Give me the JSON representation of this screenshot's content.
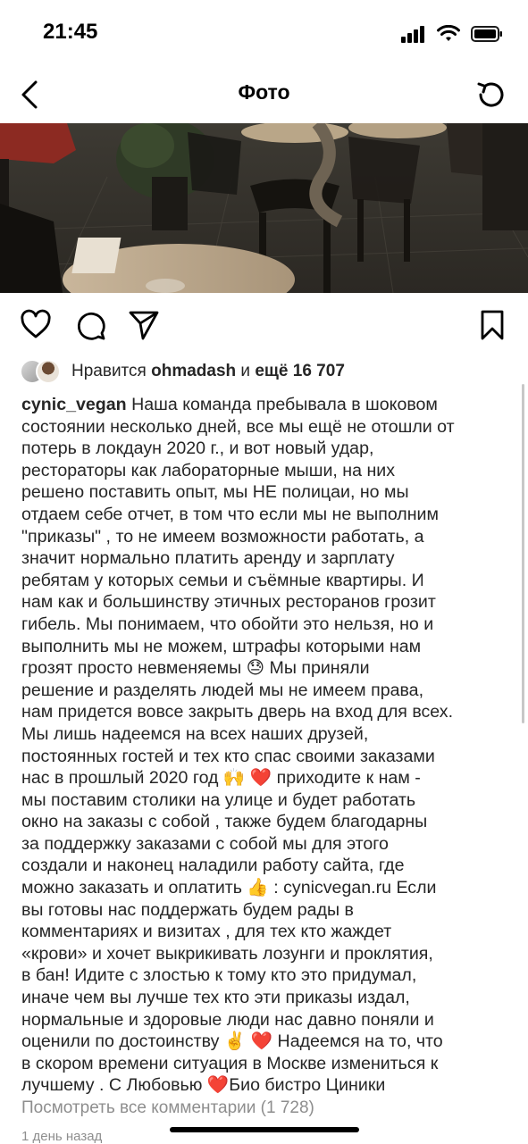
{
  "status_bar": {
    "time": "21:45"
  },
  "nav": {
    "title": "Фото",
    "back_icon": "chevron-left-icon",
    "refresh_icon": "refresh-icon"
  },
  "photo": {
    "content": "cafe-interior-photo"
  },
  "actions": {
    "like_icon": "heart-icon",
    "comment_icon": "comment-icon",
    "share_icon": "send-icon",
    "save_icon": "bookmark-icon"
  },
  "likes": {
    "prefix": "Нравится ",
    "user": "ohmadash",
    "joiner": " и ",
    "count_text": "ещё 16 707"
  },
  "caption": {
    "username": "cynic_vegan",
    "text": " Наша команда пребывала в шоковом\nсостоянии несколько дней, все мы ещё не отошли от\nпотерь в локдаун 2020 г., и вот новый удар,\nрестораторы как лабораторные мыши, на них\nрешено поставить опыт, мы НЕ полицаи, но мы\nотдаем себе отчет, в том что если мы не выполним\n\"приказы\" , то не имеем возможности работать, а\nзначит нормально платить аренду и зарплату\nребятам у которых семьи и съёмные квартиры.  И\nнам как и большинству этичных ресторанов грозит\nгибель.  Мы понимаем, что обойти это нельзя, но и\nвыполнить мы не можем, штрафы которыми нам\nгрозят просто невменяемы 😓  Мы приняли\nрешение и разделять людей мы не имеем права,\nнам придется вовсе закрыть дверь на вход для всех.\nМы лишь надеемся на всех наших друзей,\nпостоянных гостей и тех кто спас своими заказами\nнас в прошлый 2020 год 🙌 ❤️  приходите к нам -\nмы поставим столики на улице и будет работать\nокно на заказы с собой , также будем благодарны\nза поддержку  заказами с собой мы для этого\nсоздали и наконец наладили работу сайта, где\nможно заказать и оплатить 👍 : cynicvegan.ru  Если\nвы готовы нас поддержать будем рады в\nкомментариях и визитах , для тех кто жаждет\n«крови» и хочет выкрикивать лозунги и проклятия,\nв бан! Идите с злостью к тому кто это придумал,\nиначе чем вы лучше тех кто эти приказы издал,\nнормальные и здоровые люди нас давно поняли и\nоценили по достоинству ✌️ ❤️  Надеемся на то, что\nв скором времени ситуация в Москве измениться к\nлучшему .  С Любовью ❤️Био бистро Циники"
  },
  "view_comments": "Посмотреть все комментарии (1 728)",
  "post_date": "1 день назад"
}
